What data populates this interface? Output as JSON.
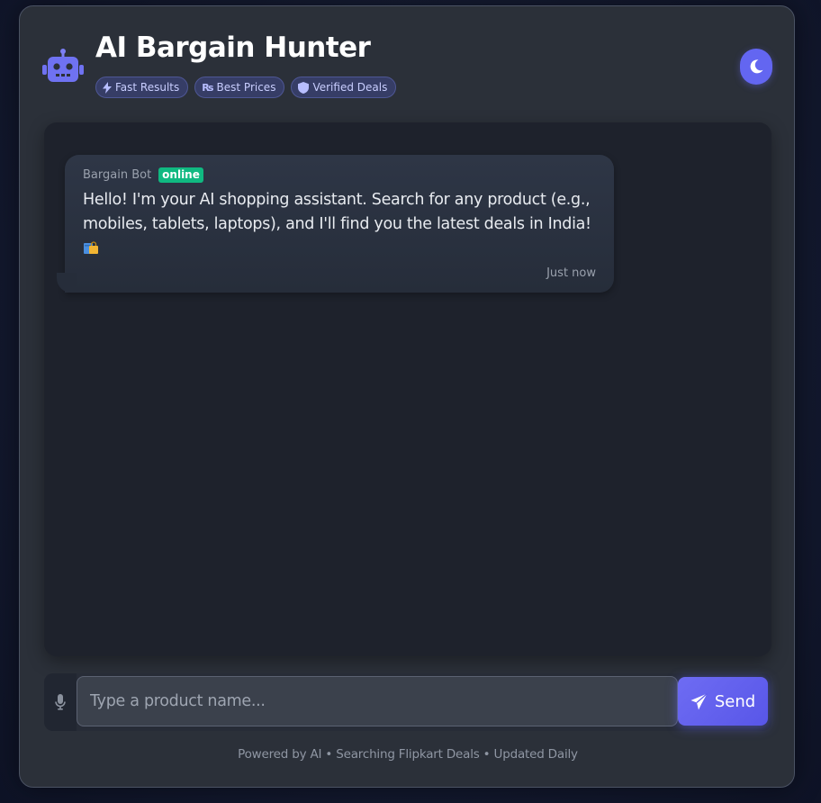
{
  "header": {
    "title": "AI Bargain Hunter",
    "logo_icon": "robot-icon",
    "badges": [
      {
        "icon": "bolt-icon",
        "label": "Fast Results"
      },
      {
        "icon": "rupee-icon",
        "label": "Best Prices",
        "icon_text": "₨"
      },
      {
        "icon": "shield-icon",
        "label": "Verified Deals"
      }
    ],
    "theme_toggle_icon": "moon-icon"
  },
  "chat": {
    "messages": [
      {
        "sender": "Bargain Bot",
        "status": "online",
        "text": "Hello! I'm your AI shopping assistant. Search for any product (e.g., mobiles, tablets, laptops), and I'll find you the latest deals in India!",
        "emoji_icon": "shopping-bags-emoji-icon",
        "time": "Just now"
      }
    ]
  },
  "input": {
    "mic_icon": "microphone-icon",
    "placeholder": "Type a product name...",
    "value": "",
    "send_label": "Send",
    "send_icon": "paper-plane-icon"
  },
  "footer": {
    "text": "Powered by AI • Searching Flipkart Deals • Updated Daily"
  },
  "colors": {
    "accent": "#6366f1",
    "online": "#10b981",
    "card_bg": "#2b3039",
    "chat_bg": "#1e222c"
  }
}
